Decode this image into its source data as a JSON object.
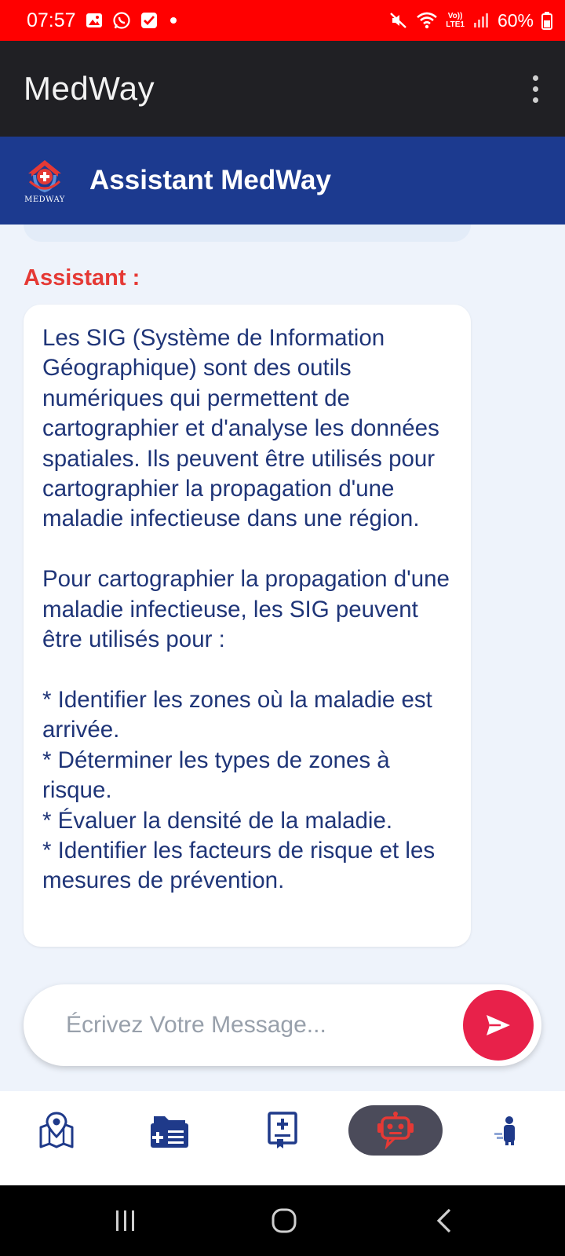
{
  "status_bar": {
    "time": "07:57",
    "battery": "60%",
    "network_label": "LTE1",
    "icons": [
      "gallery-icon",
      "whatsapp-icon",
      "checkbox-notification-icon",
      "dot-icon",
      "mute-icon",
      "wifi-icon",
      "volte-icon",
      "signal-icon",
      "battery-icon"
    ]
  },
  "app_bar": {
    "title": "MedWay",
    "menu_icon": "overflow-menu-icon"
  },
  "chat_header": {
    "logo_caption": "MEDWAY",
    "title": "Assistant MedWay"
  },
  "conversation": {
    "sender": "Assistant :",
    "message": "Les SIG (Système de Information Géographique) sont des outils numériques qui permettent de cartographier et d'analyse les données spatiales. Ils peuvent être utilisés pour cartographier la propagation d'une maladie infectieuse dans une région.\n\nPour cartographier la propagation d'une maladie infectieuse, les SIG peuvent être utilisés pour :\n\n* Identifier les zones où la maladie est arrivée.\n* Déterminer les types de zones à risque.\n* Évaluer la densité de la maladie.\n* Identifier les facteurs de risque et les mesures de prévention."
  },
  "composer": {
    "placeholder": "Écrivez Votre Message...",
    "send_icon": "send-icon"
  },
  "bottom_nav": {
    "items": [
      {
        "icon": "map-pin-icon",
        "active": false
      },
      {
        "icon": "medical-folder-icon",
        "active": false
      },
      {
        "icon": "medical-record-icon",
        "active": false
      },
      {
        "icon": "chatbot-icon",
        "active": true
      },
      {
        "icon": "profile-icon",
        "active": false
      }
    ]
  },
  "colors": {
    "status_bar": "#ff0000",
    "app_bar": "#202024",
    "header": "#1c3a8f",
    "accent_red": "#e53935",
    "send_button": "#e8214a",
    "message_text": "#1f3578",
    "nav_icon": "#1f3a8a"
  }
}
